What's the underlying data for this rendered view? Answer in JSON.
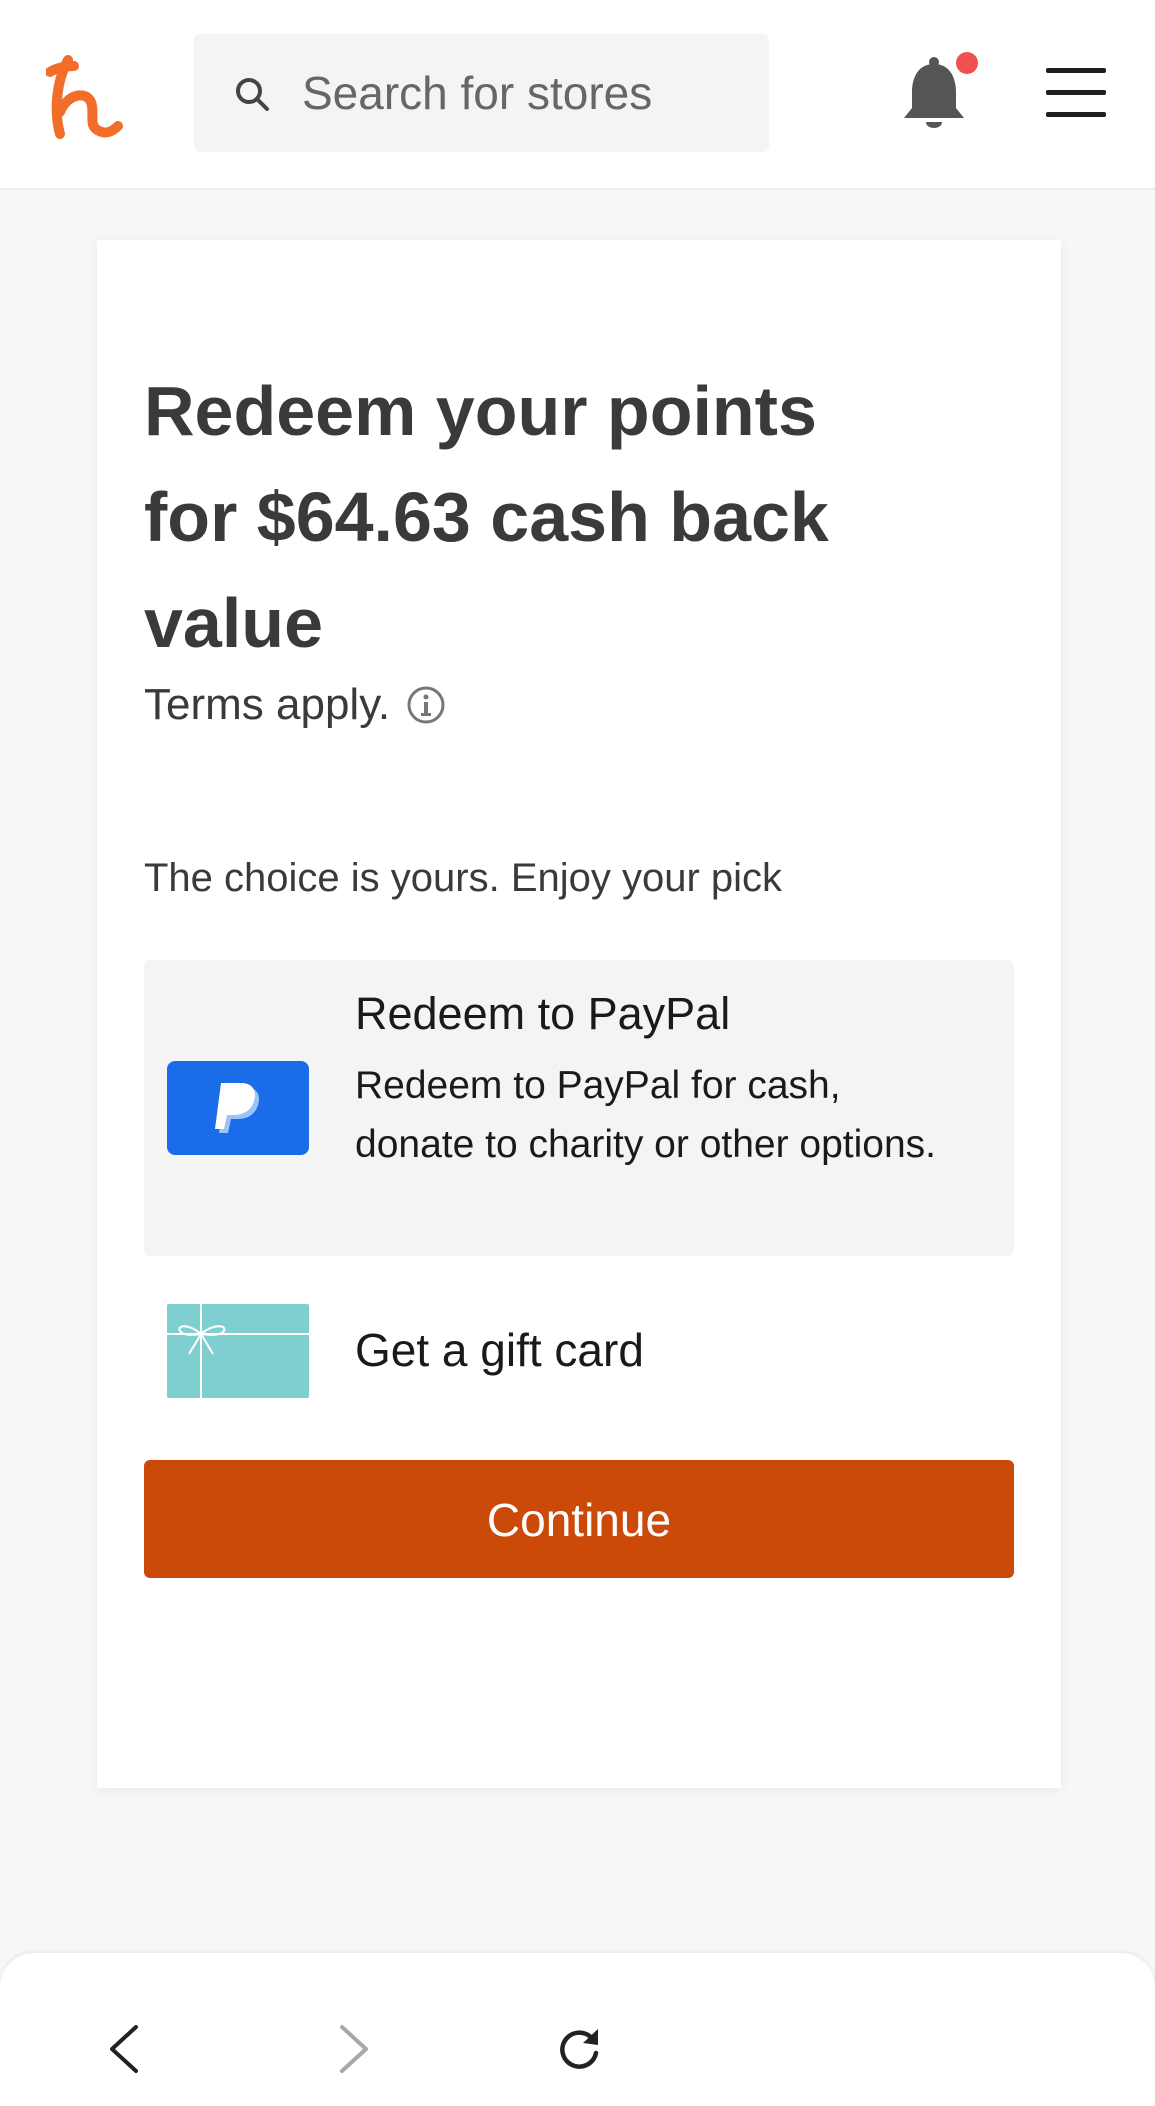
{
  "header": {
    "logo_icon": "honey-h-logo",
    "search": {
      "placeholder": "Search for stores",
      "icon": "search-icon"
    },
    "notifications": {
      "icon": "bell-icon",
      "has_unread": true,
      "dot_color": "#f0504f"
    },
    "menu_icon": "hamburger-menu-icon"
  },
  "card": {
    "title": "Redeem your points for $64.63 cash back value",
    "terms": "Terms apply.",
    "terms_icon": "info-icon",
    "choice_text": "The choice is yours. Enjoy your pick",
    "options": [
      {
        "title": "Redeem to PayPal",
        "description": "Redeem to PayPal for cash, donate to charity or other options.",
        "icon": "paypal-icon",
        "selected": true
      },
      {
        "title": "Get a gift card",
        "icon": "gift-card-icon",
        "selected": false
      }
    ],
    "continue_label": "Continue",
    "accent_color": "#cc4a09"
  },
  "browser_bar": {
    "back_icon": "chevron-left-icon",
    "forward_icon": "chevron-right-icon",
    "reload_icon": "reload-icon"
  }
}
